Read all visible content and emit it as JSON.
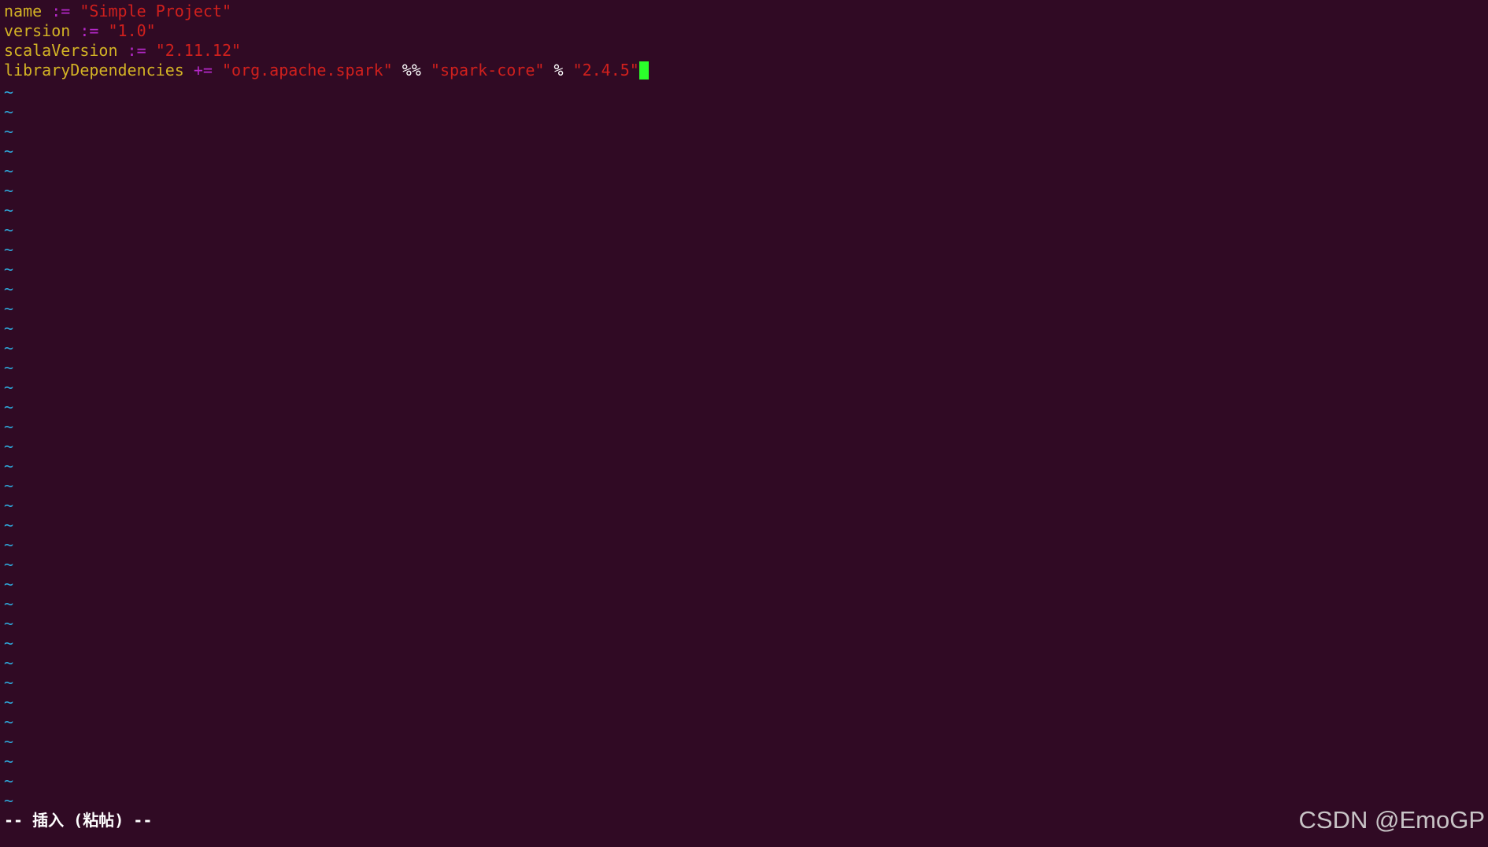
{
  "editor": {
    "lines": [
      {
        "identifier": "name",
        "operator": ":=",
        "value": "\"Simple Project\""
      },
      {
        "identifier": "version",
        "operator": ":=",
        "value": "\"1.0\""
      },
      {
        "identifier": "scalaVersion",
        "operator": ":=",
        "value": "\"2.11.12\""
      },
      {
        "identifier": "libraryDependencies",
        "operator": "+=",
        "group": "\"org.apache.spark\"",
        "sep1": "%%",
        "artifact": "\"spark-core\"",
        "sep2": "%",
        "version": "\"2.4.5\""
      }
    ],
    "empty_line_marker": "~",
    "empty_line_count": 37
  },
  "status": {
    "mode_text": "-- 插入 (粘帖) --"
  },
  "watermark": {
    "text": "CSDN @EmoGP"
  },
  "colors": {
    "background": "#300a24",
    "identifier": "#d3b325",
    "operator": "#b428c8",
    "string": "#d0201d",
    "tilde": "#2ea6d8",
    "cursor": "#2bff2b"
  }
}
